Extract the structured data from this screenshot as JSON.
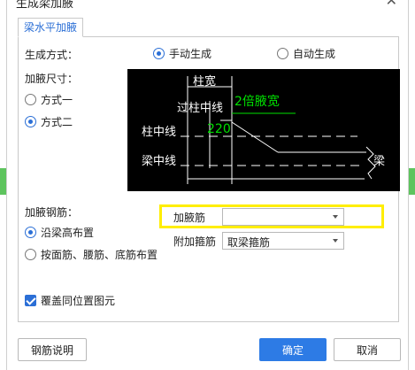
{
  "window": {
    "title": "生成梁加腋"
  },
  "tab": {
    "label": "梁水平加腋"
  },
  "generation": {
    "label": "生成方式：",
    "manual": "手动生成",
    "auto": "自动生成",
    "selected": "manual"
  },
  "size": {
    "label": "加腋尺寸：",
    "option1": "方式一",
    "option2": "方式二",
    "selected": "option2"
  },
  "diagram_labels": {
    "column_width": "柱宽",
    "through_column_line": "过柱中线",
    "double_haunch_width": "2倍腋宽",
    "dimension": "220",
    "column_center_line": "柱中线",
    "beam_center_line": "梁中线",
    "beam": "梁"
  },
  "rebar": {
    "label": "加腋钢筋：",
    "along_beam_height": "沿梁高布置",
    "by_face": "按面筋、腰筋、底筋布置",
    "selected": "along_beam_height"
  },
  "fields": {
    "haunch_bar_label": "加腋筋",
    "haunch_bar_value": "",
    "stirrup_label": "附加箍筋",
    "stirrup_value": "取梁箍筋"
  },
  "overwrite": {
    "label": "覆盖同位置图元",
    "checked": true
  },
  "buttons": {
    "help": "钢筋说明",
    "ok": "确定",
    "cancel": "取消"
  },
  "colors": {
    "accent": "#2d7be5",
    "highlight": "#ffee00",
    "diagram_bg": "#000000",
    "diagram_text": "#ffffff",
    "diagram_green": "#00e000"
  }
}
